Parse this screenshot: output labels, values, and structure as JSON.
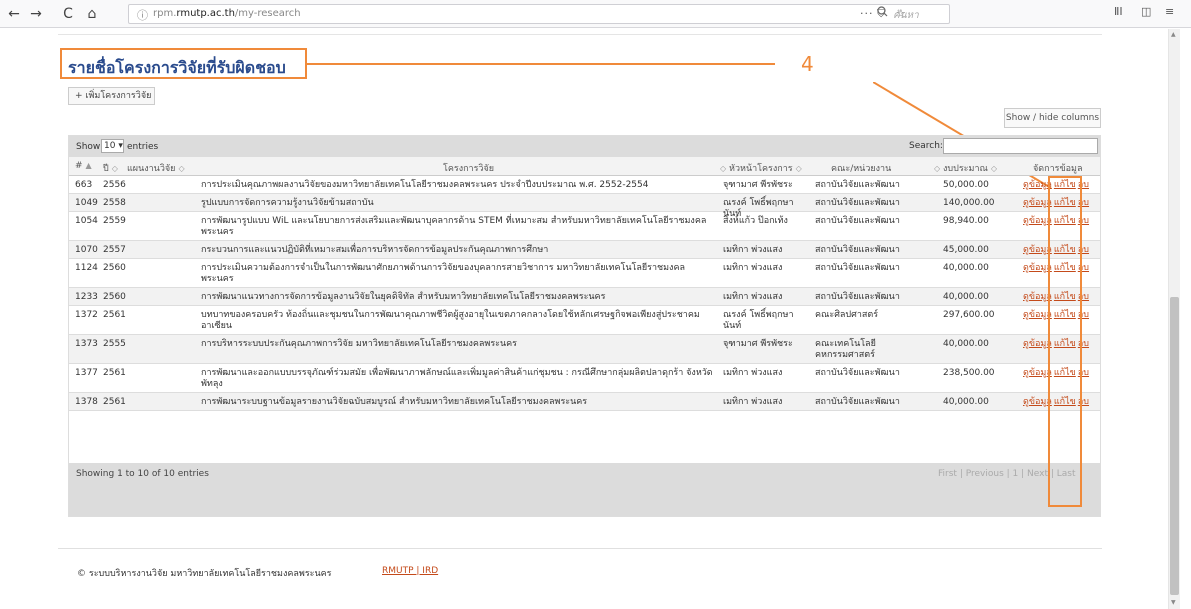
{
  "browser": {
    "back": "←",
    "forward": "→",
    "reload": "C",
    "home": "⌂",
    "info": "ⓘ",
    "url_prefix": "rpm.",
    "url_domain": "rmutp.ac.th",
    "url_path": "/my-research",
    "more": "···",
    "pocket": "⛉",
    "star": "☆",
    "search_icon": "🔍",
    "search_placeholder": "ค้นหา",
    "library": "ⅡⅠ",
    "sidebar": "◫",
    "menu": "≡"
  },
  "page": {
    "title": "รายชื่อโครงการวิจัยที่รับผิดชอบ",
    "callout_number": "4",
    "add_button": "+ เพิ่มโครงการวิจัย",
    "showhide_button": "Show / hide columns"
  },
  "table_controls": {
    "show_label": "Show",
    "page_length": "10 ▾",
    "entries_label": "entries",
    "search_label": "Search:"
  },
  "columns": [
    "#",
    "ปี",
    "แผนงานวิจัย",
    "โครงการวิจัย",
    "หัวหน้าโครงการ",
    "คณะ/หน่วยงาน",
    "งบประมาณ",
    "จัดการข้อมูล"
  ],
  "rows": [
    {
      "id": "663",
      "year": "2556",
      "project": "การประเมินคุณภาพผลงานวิจัยของมหาวิทยาลัยเทคโนโลยีราชมงคลพระนคร ประจำปีงบประมาณ พ.ศ. 2552-2554",
      "head": "จุฑามาศ พีรพัชระ",
      "dept": "สถาบันวิจัยและพัฒนา",
      "budget": "50,000.00"
    },
    {
      "id": "1049",
      "year": "2558",
      "project": "รูปแบบการจัดการความรู้งานวิจัยข้ามสถาบัน",
      "head": "ณรงค์ โพธิ์พฤกษานันท์",
      "dept": "สถาบันวิจัยและพัฒนา",
      "budget": "140,000.00"
    },
    {
      "id": "1054",
      "year": "2559",
      "project": "การพัฒนารูปแบบ WiL และนโยบายการส่งเสริมและพัฒนาบุคลากรด้าน STEM ที่เหมาะสม สำหรับมหาวิทยาลัยเทคโนโลยีราชมงคลพระนคร",
      "head": "สิงห์แก้ว ป๊อกเท้ง",
      "dept": "สถาบันวิจัยและพัฒนา",
      "budget": "98,940.00"
    },
    {
      "id": "1070",
      "year": "2557",
      "project": "กระบวนการและแนวปฏิบัติที่เหมาะสมเพื่อการบริหารจัดการข้อมูลประกันคุณภาพการศึกษา",
      "head": "เมทิกา พ่วงแสง",
      "dept": "สถาบันวิจัยและพัฒนา",
      "budget": "45,000.00"
    },
    {
      "id": "1124",
      "year": "2560",
      "project": "การประเมินความต้องการจำเป็นในการพัฒนาศักยภาพด้านการวิจัยของบุคลากรสายวิชาการ มหาวิทยาลัยเทคโนโลยีราชมงคลพระนคร",
      "head": "เมทิกา พ่วงแสง",
      "dept": "สถาบันวิจัยและพัฒนา",
      "budget": "40,000.00"
    },
    {
      "id": "1233",
      "year": "2560",
      "project": "การพัฒนาแนวทางการจัดการข้อมูลงานวิจัยในยุคดิจิทัล สำหรับมหาวิทยาลัยเทคโนโลยีราชมงคลพระนคร",
      "head": "เมทิกา พ่วงแสง",
      "dept": "สถาบันวิจัยและพัฒนา",
      "budget": "40,000.00"
    },
    {
      "id": "1372",
      "year": "2561",
      "project": "บทบาทของครอบครัว ท้องถิ่นและชุมชนในการพัฒนาคุณภาพชีวิตผู้สูงอายุในเขตภาคกลางโดยใช้หลักเศรษฐกิจพอเพียงสู่ประชาคมอาเซียน",
      "head": "ณรงค์ โพธิ์พฤกษานันท์",
      "dept": "คณะศิลปศาสตร์",
      "budget": "297,600.00"
    },
    {
      "id": "1373",
      "year": "2555",
      "project": "การบริหารระบบประกันคุณภาพการวิจัย มหาวิทยาลัยเทคโนโลยีราชมงคลพระนคร",
      "head": "จุฑามาศ พีรพัชระ",
      "dept": "คณะเทคโนโลยีคหกรรมศาสตร์",
      "budget": "40,000.00"
    },
    {
      "id": "1377",
      "year": "2561",
      "project": "การพัฒนาและออกแบบบรรจุภัณฑ์ร่วมสมัย เพื่อพัฒนาภาพลักษณ์และเพิ่มมูลค่าสินค้าแก่ชุมชน : กรณีศึกษากลุ่มผลิตปลาดุกร้า จังหวัดพัทลุง",
      "head": "เมทิกา พ่วงแสง",
      "dept": "สถาบันวิจัยและพัฒนา",
      "budget": "238,500.00"
    },
    {
      "id": "1378",
      "year": "2561",
      "project": "การพัฒนาระบบฐานข้อมูลรายงานวิจัยฉบับสมบูรณ์ สำหรับมหาวิทยาลัยเทคโนโลยีราชมงคลพระนคร",
      "head": "เมทิกา พ่วงแสง",
      "dept": "สถาบันวิจัยและพัฒนา",
      "budget": "40,000.00"
    }
  ],
  "actions": {
    "view": "ดูข้อมูล",
    "edit": "แก้ไข",
    "delete": "ลบ"
  },
  "table_info": "Showing 1 to 10 of 10 entries",
  "pagination": {
    "first": "First",
    "previous": "Previous",
    "current": "1",
    "next": "Next",
    "last": "Last"
  },
  "footer": {
    "copyright": "© ระบบบริหารงานวิจัย มหาวิทยาลัยเทคโนโลยีราชมงคลพระนคร",
    "links": "RMUTP | IRD"
  },
  "colors": {
    "accent_orange": "#f08a3a",
    "title_blue": "#2a4b8d",
    "link": "#c44a1a"
  }
}
